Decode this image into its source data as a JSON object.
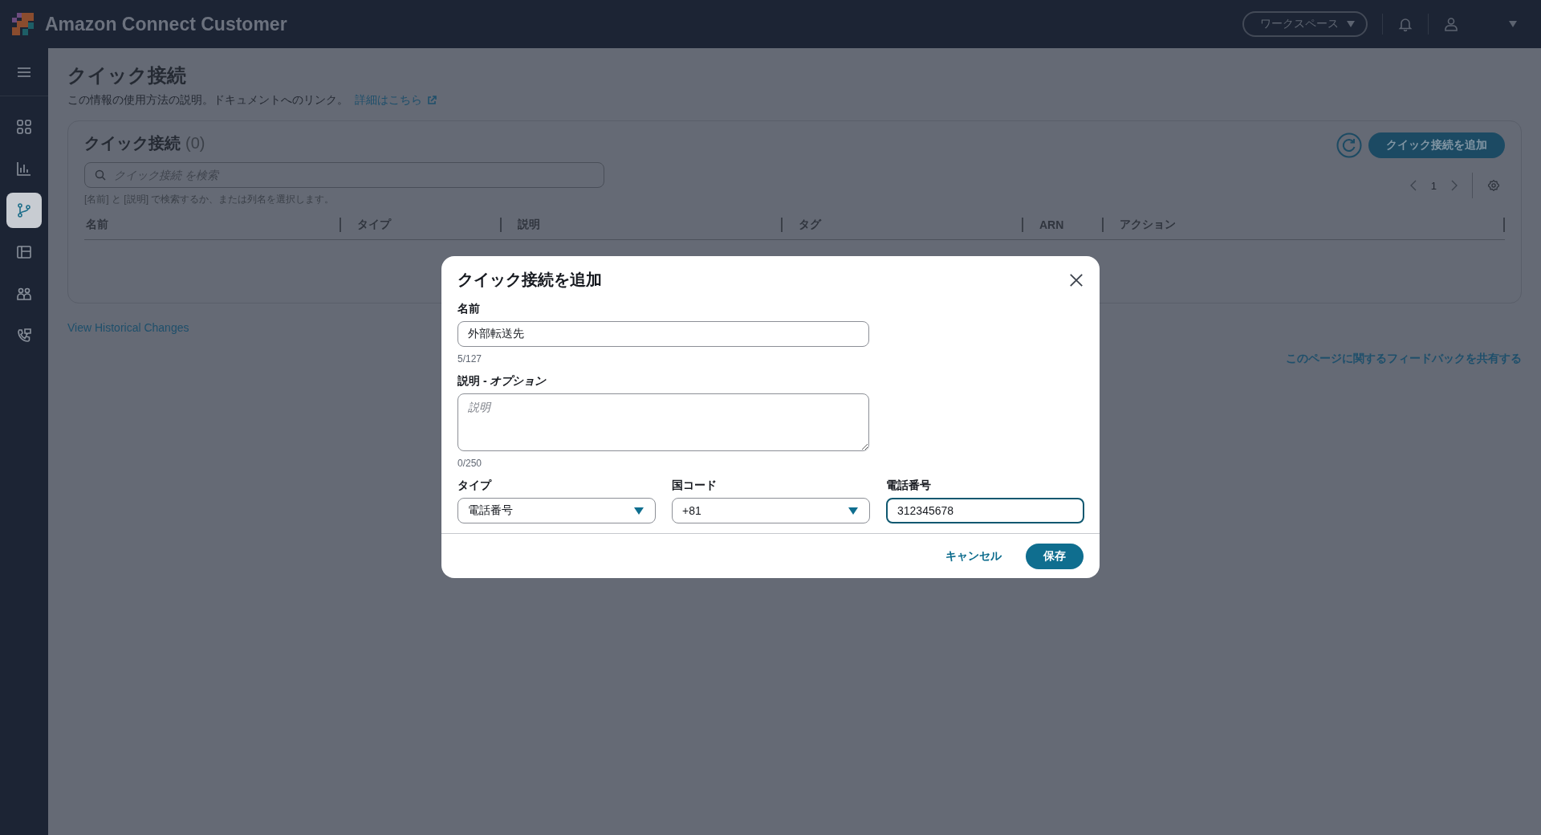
{
  "header": {
    "app_name": "Amazon Connect Customer",
    "workspace_button": "ワークスペース"
  },
  "sidebar": {
    "items": [
      {
        "selected": false
      },
      {
        "selected": false
      },
      {
        "selected": true
      },
      {
        "selected": false
      },
      {
        "selected": false
      },
      {
        "selected": false
      }
    ]
  },
  "page": {
    "title": "クイック接続",
    "description": "この情報の使用方法の説明。ドキュメントへのリンク。",
    "learn_more_link": "詳細はこちら"
  },
  "table_card": {
    "title": "クイック接続",
    "count": "(0)",
    "add_button": "クイック接続を追加",
    "search": {
      "placeholder": "クイック接続 を検索"
    },
    "search_hint": "[名前] と [説明] で検索するか、または列名を選択します。",
    "pagination": {
      "page": "1"
    },
    "columns": [
      "名前",
      "タイプ",
      "説明",
      "タグ",
      "ARN",
      "アクション"
    ]
  },
  "history_link": "View Historical Changes",
  "feedback_link": "このページに関するフィードバックを共有する",
  "modal": {
    "title": "クイック接続を追加",
    "name": {
      "label": "名前",
      "value": "外部転送先",
      "counter": "5/127"
    },
    "description": {
      "label": "説明 - *オプション*",
      "placeholder": "説明",
      "counter": "0/250"
    },
    "row_fields": [
      {
        "kind": "select",
        "label": "タイプ",
        "value": "電話番号",
        "focused": false
      },
      {
        "kind": "select",
        "label": "国コード",
        "value": "+81",
        "focused": false
      },
      {
        "kind": "input",
        "label": "電話番号",
        "value": "312345678",
        "focused": true
      }
    ],
    "cancel_button": "キャンセル",
    "save_button": "保存"
  }
}
